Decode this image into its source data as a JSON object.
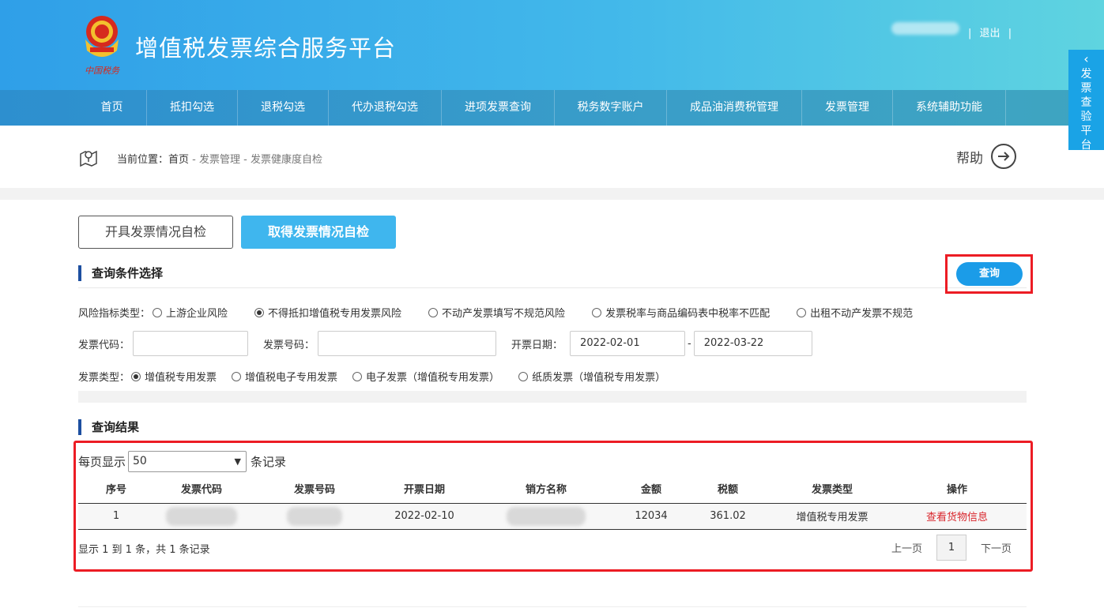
{
  "header": {
    "title": "增值税发票综合服务平台",
    "logo_text": "中国税务",
    "logout": "退出",
    "sep": "|"
  },
  "nav": {
    "items": [
      {
        "label": "首页"
      },
      {
        "label": "抵扣勾选"
      },
      {
        "label": "退税勾选"
      },
      {
        "label": "代办退税勾选"
      },
      {
        "label": "进项发票查询"
      },
      {
        "label": "税务数字账户"
      },
      {
        "label": "成品油消费税管理"
      },
      {
        "label": "发票管理"
      },
      {
        "label": "系统辅助功能"
      }
    ]
  },
  "side_tab": {
    "label": "发票查验平台"
  },
  "breadcrumb": {
    "prefix": "当前位置：",
    "home": "首页",
    "sep": " - ",
    "level2": "发票管理",
    "level3": "发票健康度自检"
  },
  "help": {
    "label": "帮助"
  },
  "tabs": {
    "issued": "开具发票情况自检",
    "received": "取得发票情况自检"
  },
  "query_section": {
    "title": "查询条件选择",
    "query_button": "查询",
    "risk_label": "风险指标类型：",
    "risk_options": [
      {
        "label": "上游企业风险",
        "checked": false
      },
      {
        "label": "不得抵扣增值税专用发票风险",
        "checked": true
      },
      {
        "label": "不动产发票填写不规范风险",
        "checked": false
      },
      {
        "label": "发票税率与商品编码表中税率不匹配",
        "checked": false
      },
      {
        "label": "出租不动产发票不规范",
        "checked": false
      }
    ],
    "code_label": "发票代码：",
    "code_value": "",
    "number_label": "发票号码：",
    "number_value": "",
    "date_label": "开票日期：",
    "date_from": "2022-02-01",
    "date_sep": "-",
    "date_to": "2022-03-22",
    "type_label": "发票类型：",
    "type_options": [
      {
        "label": "增值税专用发票",
        "checked": true
      },
      {
        "label": "增值税电子专用发票",
        "checked": false
      },
      {
        "label": "电子发票（增值税专用发票）",
        "checked": false
      },
      {
        "label": "纸质发票（增值税专用发票）",
        "checked": false
      }
    ]
  },
  "results": {
    "title": "查询结果",
    "per_page_prefix": "每页显示",
    "per_page_value": "50",
    "per_page_suffix": "条记录",
    "columns": [
      "序号",
      "发票代码",
      "发票号码",
      "开票日期",
      "销方名称",
      "金额",
      "税额",
      "发票类型",
      "操作"
    ],
    "row": {
      "index": "1",
      "date": "2022-02-10",
      "amount": "12034",
      "tax": "361.02",
      "type": "增值税专用发票",
      "action": "查看货物信息"
    },
    "summary": "显示 1 到 1 条，共 1 条记录",
    "prev": "上一页",
    "page": "1",
    "next": "下一页"
  }
}
